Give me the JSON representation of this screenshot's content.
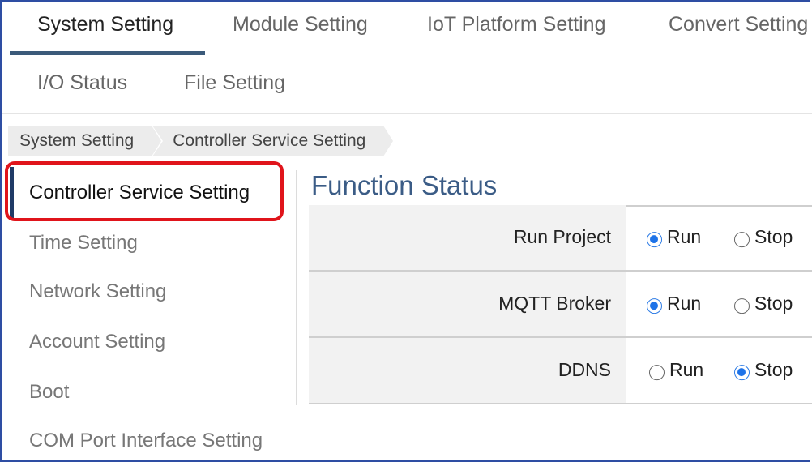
{
  "top_tabs": [
    {
      "label": "System Setting",
      "active": true
    },
    {
      "label": "Module Setting",
      "active": false
    },
    {
      "label": "IoT Platform Setting",
      "active": false
    },
    {
      "label": "Convert Setting",
      "active": false
    },
    {
      "label": "I/O Status",
      "active": false
    },
    {
      "label": "File Setting",
      "active": false
    }
  ],
  "breadcrumb": [
    "System Setting",
    "Controller Service Setting"
  ],
  "sidebar": {
    "items": [
      {
        "label": "Controller Service Setting",
        "active": true
      },
      {
        "label": "Time Setting",
        "active": false
      },
      {
        "label": "Network Setting",
        "active": false
      },
      {
        "label": "Account Setting",
        "active": false
      },
      {
        "label": "Boot",
        "active": false
      },
      {
        "label": "COM Port Interface Setting",
        "active": false
      }
    ]
  },
  "main": {
    "title": "Function Status",
    "rows": [
      {
        "label": "Run Project",
        "options": [
          "Run",
          "Stop"
        ],
        "selected": "Run"
      },
      {
        "label": "MQTT Broker",
        "options": [
          "Run",
          "Stop"
        ],
        "selected": "Run"
      },
      {
        "label": "DDNS",
        "options": [
          "Run",
          "Stop"
        ],
        "selected": "Stop"
      }
    ]
  },
  "colors": {
    "frame_border": "#2e4ea3",
    "active_tab_underline": "#3b5a7a",
    "title_blue": "#3b5c86",
    "highlight_red": "#e0141b",
    "radio_checked": "#1e73e8"
  }
}
